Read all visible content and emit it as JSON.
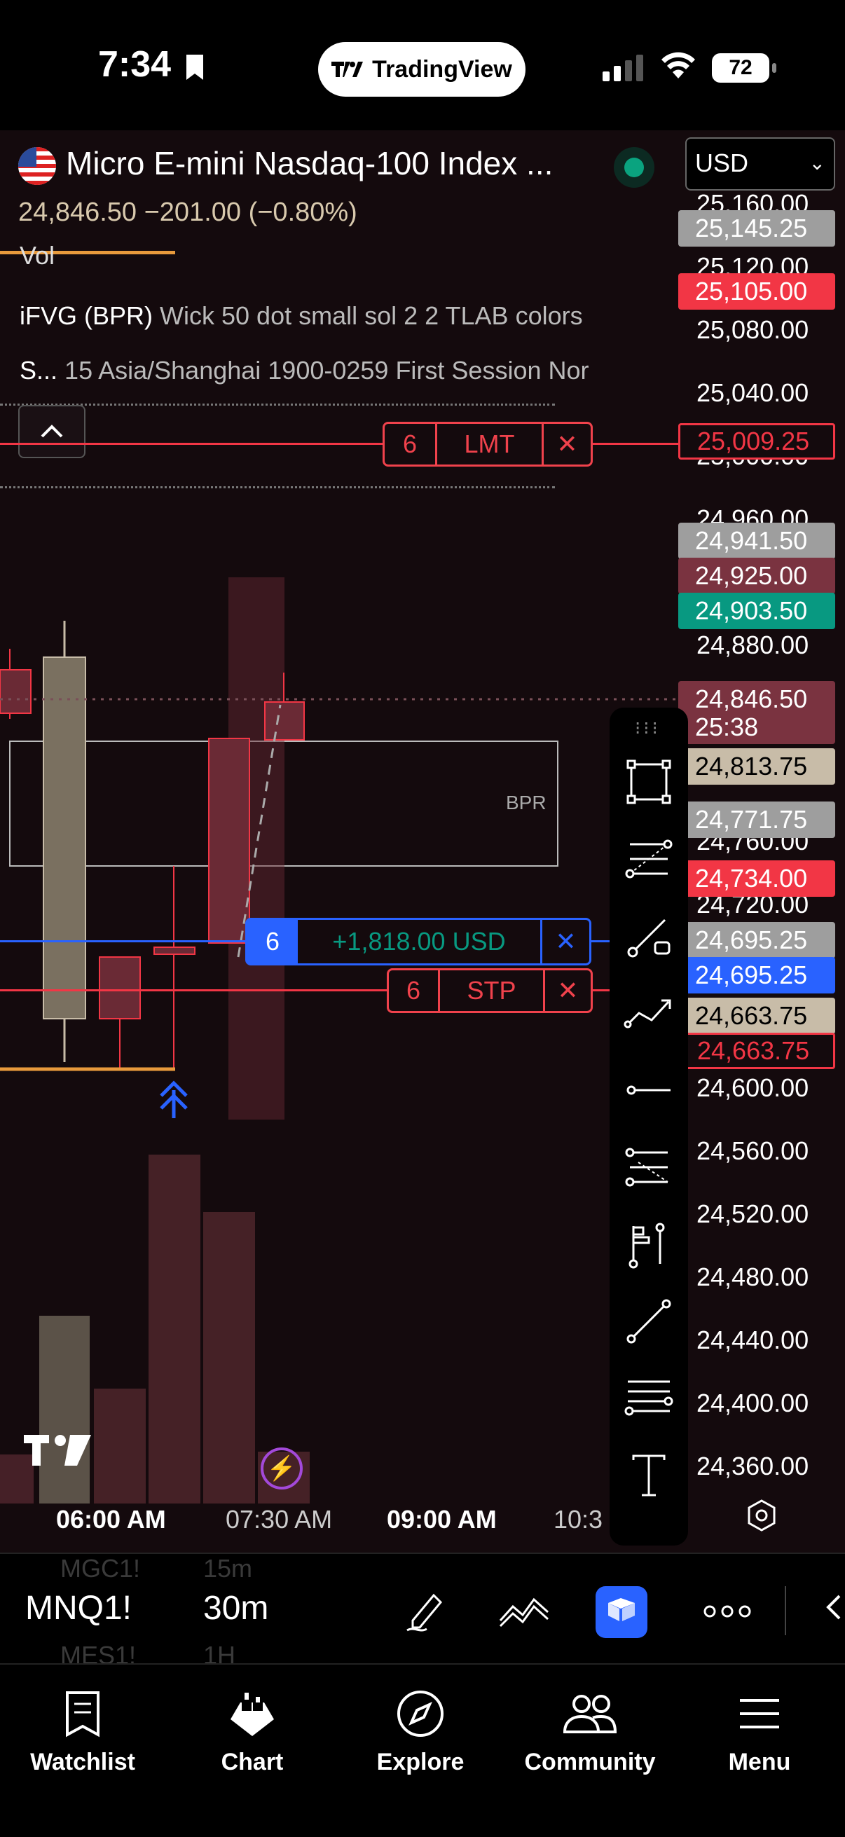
{
  "status_bar": {
    "time": "7:34",
    "app_pill": "TradingView",
    "battery": "72"
  },
  "legend": {
    "symbol_title": "Micro E-mini Nasdaq-100 Index ...",
    "price_change": "24,846.50  −201.00 (−0.80%)",
    "volume": "Vol",
    "indicator1_name": "iFVG (BPR)",
    "indicator1_params": "Wick 50 dot small sol 2 2 TLAB colors",
    "indicator2_name": "S...",
    "indicator2_params": "15 Asia/Shanghai 1900-0259 First Session Nor"
  },
  "currency": "USD",
  "zone_label": "BPR",
  "orders": {
    "limit": {
      "qty": "6",
      "type": "LMT",
      "close": "✕"
    },
    "stop": {
      "qty": "6",
      "type": "STP",
      "close": "✕"
    },
    "position": {
      "qty": "6",
      "pnl": "+1,818.00 USD",
      "close": "✕"
    }
  },
  "price_axis": {
    "ticks": [
      "25,160.00",
      "25,120.00",
      "25,080.00",
      "25,040.00",
      "25,000.00",
      "24,960.00",
      "24,880.00",
      "24,760.00",
      "24,720.00",
      "24,600.00",
      "24,560.00",
      "24,520.00",
      "24,480.00",
      "24,440.00",
      "24,400.00",
      "24,360.00"
    ],
    "labels": [
      {
        "text": "25,145.25",
        "color": "#9e9e9e"
      },
      {
        "text": "25,105.00",
        "color": "#f23645"
      },
      {
        "text": "25,009.25",
        "color": "outline"
      },
      {
        "text": "24,941.50",
        "color": "#9e9e9e"
      },
      {
        "text": "24,925.00",
        "color": "#7a3340"
      },
      {
        "text": "24,903.50",
        "color": "#089981"
      },
      {
        "text": "24,846.50",
        "color": "#7a3340"
      },
      {
        "text": "25:38",
        "color": "#7a3340"
      },
      {
        "text": "24,813.75",
        "color": "#c8bca8"
      },
      {
        "text": "24,771.75",
        "color": "#9e9e9e"
      },
      {
        "text": "24,734.00",
        "color": "#f23645"
      },
      {
        "text": "24,695.25",
        "color": "#9e9e9e"
      },
      {
        "text": "24,695.25",
        "color": "#2962ff"
      },
      {
        "text": "24,663.75",
        "color": "#c8bca8"
      },
      {
        "text": "24,663.75",
        "color": "outline"
      }
    ]
  },
  "time_axis": [
    "06:00 AM",
    "07:30 AM",
    "09:00 AM",
    "10:3"
  ],
  "symbol_bar": {
    "symbol": "MNQ1!",
    "interval": "30m",
    "ghost_symbols": [
      "MGC1!",
      "MES1!"
    ],
    "ghost_intervals": [
      "15m",
      "1H"
    ]
  },
  "tabs": [
    "Watchlist",
    "Chart",
    "Explore",
    "Community",
    "Menu"
  ],
  "colors": {
    "up": "#c8bca8",
    "down": "#f23645",
    "accent": "#2962ff",
    "profit": "#089981"
  }
}
